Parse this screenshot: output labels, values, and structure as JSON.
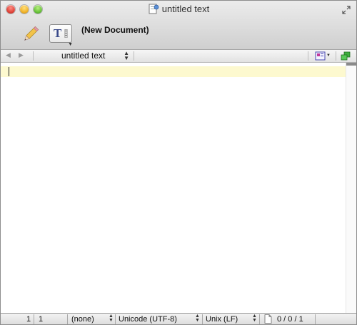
{
  "window": {
    "title": "untitled text"
  },
  "toolbar": {
    "document_name": "(New Document)"
  },
  "navbar": {
    "document_popup": "untitled text"
  },
  "statusbar": {
    "line": "1",
    "column": "1",
    "language": "(none)",
    "encoding": "Unicode (UTF-8)",
    "line_endings": "Unix (LF)",
    "counts": "0 / 0 / 1"
  },
  "icons": {
    "pencil": "pencil-icon",
    "text_options": "text-options-icon",
    "document": "document-icon"
  },
  "colors": {
    "current_line_highlight": "#fdf9cf",
    "traffic_close": "#e0443a",
    "traffic_minimize": "#f0b22a",
    "traffic_maximize": "#68c23a"
  }
}
